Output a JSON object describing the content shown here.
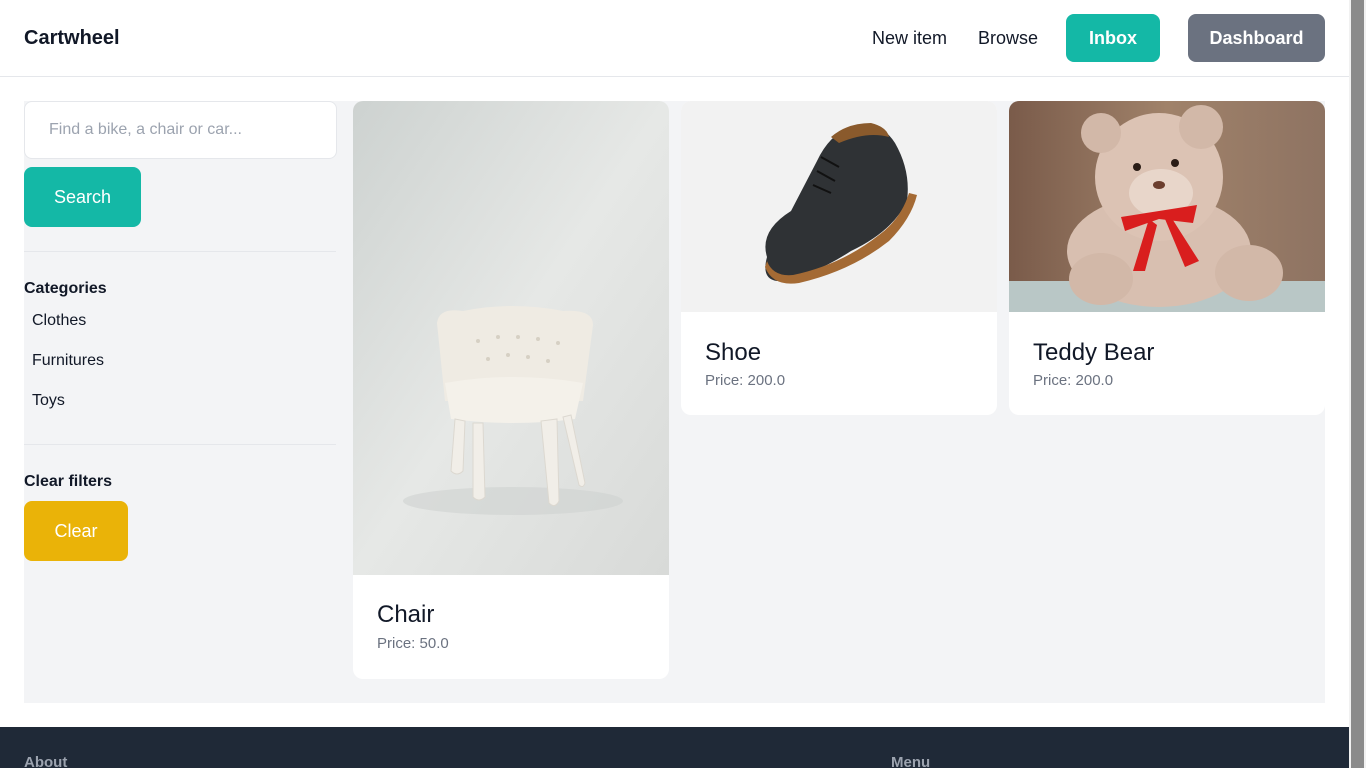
{
  "header": {
    "logo": "Cartwheel",
    "nav": {
      "new_item": "New item",
      "browse": "Browse"
    },
    "inbox_label": "Inbox",
    "dashboard_label": "Dashboard"
  },
  "sidebar": {
    "search": {
      "placeholder": "Find a bike, a chair or car...",
      "value": "",
      "button_label": "Search"
    },
    "categories_title": "Categories",
    "categories": [
      "Clothes",
      "Furnitures",
      "Toys"
    ],
    "clear_title": "Clear filters",
    "clear_label": "Clear"
  },
  "items": [
    {
      "name": "Chair",
      "price": "Price: 50.0"
    },
    {
      "name": "Shoe",
      "price": "Price: 200.0"
    },
    {
      "name": "Teddy Bear",
      "price": "Price: 200.0"
    }
  ],
  "footer": {
    "about": "About",
    "menu": "Menu"
  },
  "colors": {
    "accent": "#14b8a6",
    "secondary": "#6b7280",
    "warning": "#eab308",
    "footer_bg": "#1f2937",
    "page_bg": "#f3f4f6"
  }
}
